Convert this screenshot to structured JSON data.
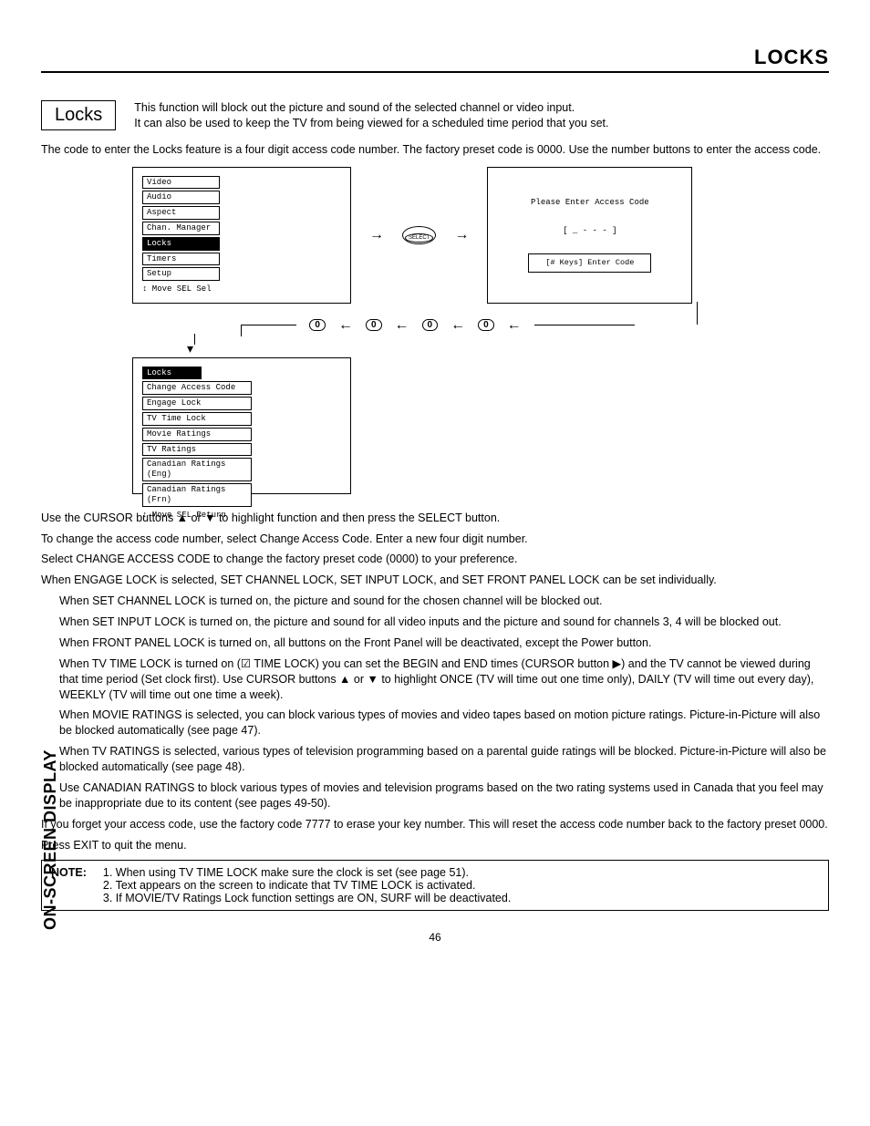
{
  "header": {
    "title": "LOCKS"
  },
  "section_title": "Locks",
  "intro": {
    "l1": "This function will block out the picture and sound of the selected channel or video input.",
    "l2": "It can also be used to keep the TV from being viewed for a scheduled time period that you set."
  },
  "para1": "The code to enter the Locks feature is a four digit access code number.  The factory preset code is 0000.  Use the number buttons to enter the access code.",
  "osd_main": {
    "items": [
      "Video",
      "Audio",
      "Aspect",
      "Chan. Manager",
      "Locks",
      "Timers",
      "Setup"
    ],
    "selected": "Locks",
    "footer": "↕ Move  SEL Sel"
  },
  "select_label": "SELECT",
  "access_screen": {
    "line1": "Please Enter Access Code",
    "line2": "[ _ - - - ]",
    "line3": "[# Keys] Enter Code"
  },
  "digits": [
    "0",
    "0",
    "0",
    "0"
  ],
  "osd_locks": {
    "title": "Locks",
    "items": [
      "Change Access Code",
      "Engage Lock",
      "TV Time Lock",
      "Movie Ratings",
      "TV Ratings",
      "Canadian Ratings (Eng)",
      "Canadian Ratings (Frn)"
    ],
    "footer": "↕ Move  SEL Return"
  },
  "body": {
    "p1": "Use the CURSOR buttons ▲ or ▼ to highlight function and then press the SELECT button.",
    "p2": "To change the access code number, select Change Access Code.  Enter a new four digit number.",
    "p3": "Select CHANGE ACCESS CODE to change the factory preset code (0000) to your preference.",
    "p4": "When ENGAGE LOCK is selected, SET CHANNEL LOCK, SET INPUT LOCK, and SET FRONT PANEL LOCK can be set individually.",
    "p5": "When SET CHANNEL LOCK is turned on, the picture and sound for the chosen channel will be blocked out.",
    "p6": "When SET INPUT LOCK is turned on, the picture and sound for all video inputs and the picture and sound for channels 3, 4 will be blocked out.",
    "p7": "When FRONT PANEL LOCK is turned on, all buttons on the Front Panel will be deactivated, except the Power button.",
    "p8": "When TV TIME LOCK is turned on (☑ TIME LOCK) you can set the BEGIN and END times (CURSOR button ▶) and the TV cannot be viewed during that time period (Set clock first). Use CURSOR buttons ▲ or ▼ to highlight ONCE (TV will time out one time only), DAILY (TV will time out every day), WEEKLY (TV will time out one time a week).",
    "p9": "When MOVIE RATINGS is selected, you can block various types of movies and video tapes based on motion picture ratings.  Picture-in-Picture will also be blocked automatically (see page 47).",
    "p10": "When TV RATINGS is selected, various types of television programming based on a parental guide ratings will be blocked.  Picture-in-Picture will also be blocked automatically (see page 48).",
    "p11": "Use CANADIAN RATINGS to block various types of movies and television programs based on the two rating systems used in Canada that you feel may be inappropriate due to its content (see pages 49-50).",
    "p12": "If you forget your access code, use the factory code 7777 to erase your key number. This will reset the access code number back to the factory preset 0000.",
    "p13": "Press EXIT to quit the menu."
  },
  "note": {
    "label": "NOTE:",
    "n1": "1. When using TV TIME LOCK make sure the clock is set (see page 51).",
    "n2": "2. Text appears on the screen to indicate that TV TIME LOCK is activated.",
    "n3": "3. If MOVIE/TV Ratings Lock function settings are ON, SURF will be deactivated."
  },
  "sidebar": "ON-SCREEN DISPLAY",
  "page_number": "46"
}
